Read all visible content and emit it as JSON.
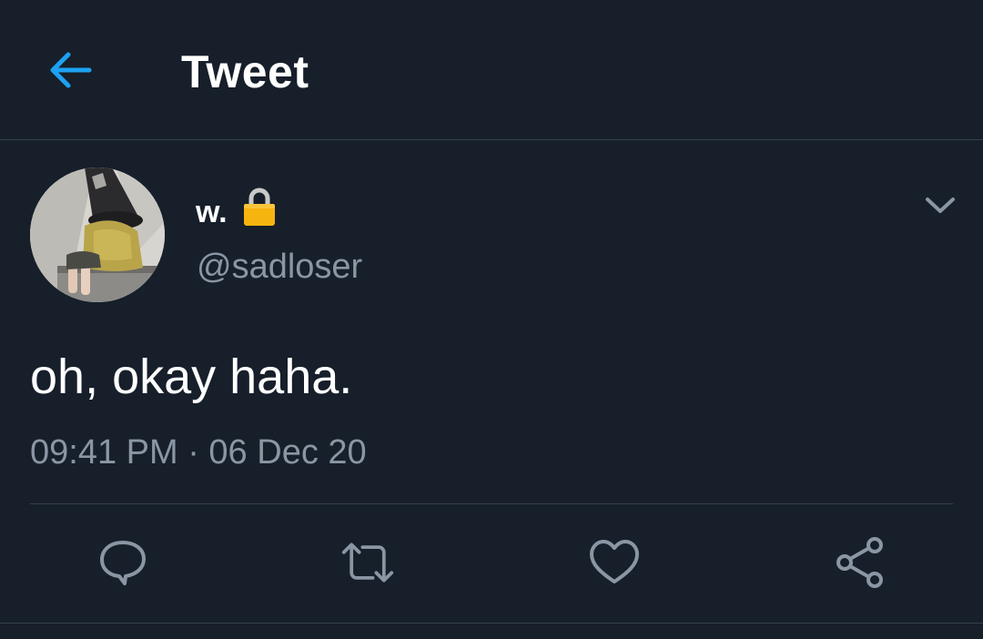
{
  "header": {
    "title": "Tweet",
    "back_icon": "arrow-left-icon"
  },
  "tweet": {
    "display_name": "w.",
    "protected_icon": "lock-icon",
    "handle": "@sadloser",
    "text": "oh, okay haha.",
    "timestamp": "09:41 PM · 06 Dec 20",
    "menu_icon": "chevron-down-icon"
  },
  "actions": [
    {
      "name": "reply",
      "icon": "speech-bubble-icon"
    },
    {
      "name": "retweet",
      "icon": "retweet-arrows-icon"
    },
    {
      "name": "like",
      "icon": "heart-outline-icon"
    },
    {
      "name": "share",
      "icon": "share-nodes-icon"
    }
  ],
  "colors": {
    "background": "#161f2a",
    "accent": "#1da1f2",
    "secondary_text": "#8a96a3",
    "divider": "#37414c",
    "lock": "#f6b40e"
  }
}
